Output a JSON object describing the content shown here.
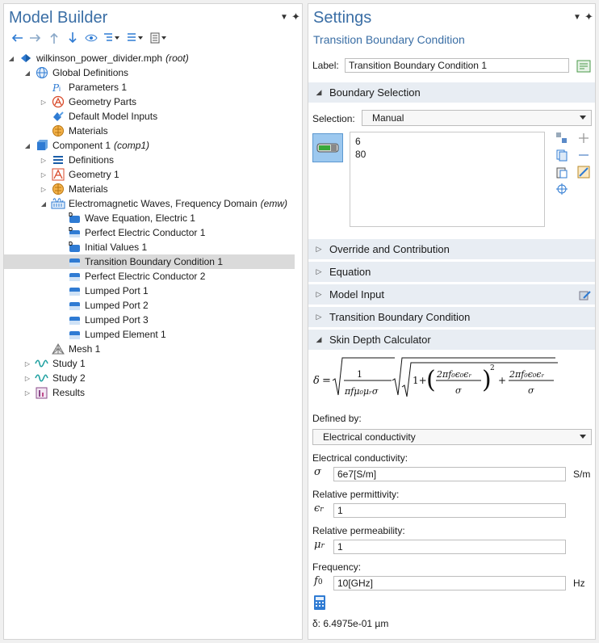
{
  "model_builder": {
    "title": "Model Builder",
    "tree": [
      {
        "label": "wilkinson_power_divider.mph",
        "tag": "(root)",
        "icon": "model-file-icon",
        "expanded": true
      },
      {
        "label": "Global Definitions",
        "icon": "globe-icon",
        "expanded": true
      },
      {
        "label": "Parameters 1",
        "icon": "parameters-icon"
      },
      {
        "label": "Geometry Parts",
        "icon": "geometry-parts-icon",
        "expanded": false
      },
      {
        "label": "Default Model Inputs",
        "icon": "model-inputs-icon"
      },
      {
        "label": "Materials",
        "icon": "materials-icon"
      },
      {
        "label": "Component 1",
        "tag": "(comp1)",
        "icon": "component-icon",
        "expanded": true
      },
      {
        "label": "Definitions",
        "icon": "definitions-icon",
        "expanded": false
      },
      {
        "label": "Geometry 1",
        "icon": "geometry-icon",
        "expanded": false
      },
      {
        "label": "Materials",
        "icon": "materials-icon",
        "expanded": false
      },
      {
        "label": "Electromagnetic Waves, Frequency Domain",
        "tag": "(emw)",
        "icon": "physics-icon",
        "expanded": true
      },
      {
        "label": "Wave Equation, Electric 1",
        "icon": "domain-feature-icon"
      },
      {
        "label": "Perfect Electric Conductor 1",
        "icon": "default-boundary-icon"
      },
      {
        "label": "Initial Values 1",
        "icon": "domain-feature-icon"
      },
      {
        "label": "Transition Boundary Condition 1",
        "icon": "boundary-feature-icon",
        "selected": true
      },
      {
        "label": "Perfect Electric Conductor 2",
        "icon": "boundary-feature-icon"
      },
      {
        "label": "Lumped Port 1",
        "icon": "boundary-feature-icon"
      },
      {
        "label": "Lumped Port 2",
        "icon": "boundary-feature-icon"
      },
      {
        "label": "Lumped Port 3",
        "icon": "boundary-feature-icon"
      },
      {
        "label": "Lumped Element 1",
        "icon": "boundary-feature-icon"
      },
      {
        "label": "Mesh 1",
        "icon": "mesh-icon"
      },
      {
        "label": "Study 1",
        "icon": "study-icon",
        "expanded": false
      },
      {
        "label": "Study 2",
        "icon": "study-icon",
        "expanded": false
      },
      {
        "label": "Results",
        "icon": "results-icon",
        "expanded": false
      }
    ]
  },
  "settings": {
    "title": "Settings",
    "subtitle": "Transition Boundary Condition",
    "label_caption": "Label:",
    "label_value": "Transition Boundary Condition 1",
    "boundary_selection": {
      "title": "Boundary Selection",
      "selection_caption": "Selection:",
      "selection_value": "Manual",
      "items": [
        "6",
        "80"
      ]
    },
    "sections": [
      "Override and Contribution",
      "Equation",
      "Model Input",
      "Transition Boundary Condition"
    ],
    "skin_depth": {
      "title": "Skin Depth Calculator",
      "defined_by_caption": "Defined by:",
      "defined_by_value": "Electrical conductivity",
      "conductivity_caption": "Electrical conductivity:",
      "conductivity_symbol": "σ",
      "conductivity_value": "6e7[S/m]",
      "conductivity_unit": "S/m",
      "permittivity_caption": "Relative permittivity:",
      "permittivity_value": "1",
      "permeability_caption": "Relative permeability:",
      "permeability_value": "1",
      "frequency_caption": "Frequency:",
      "frequency_value": "10[GHz]",
      "frequency_unit": "Hz",
      "result": "δ: 6.4975e-01 µm"
    }
  },
  "colors": {
    "title_blue": "#3a6ea5",
    "section_bg": "#e8edf3",
    "selected_row": "#dadada",
    "accent_blue": "#2f7bd3"
  }
}
